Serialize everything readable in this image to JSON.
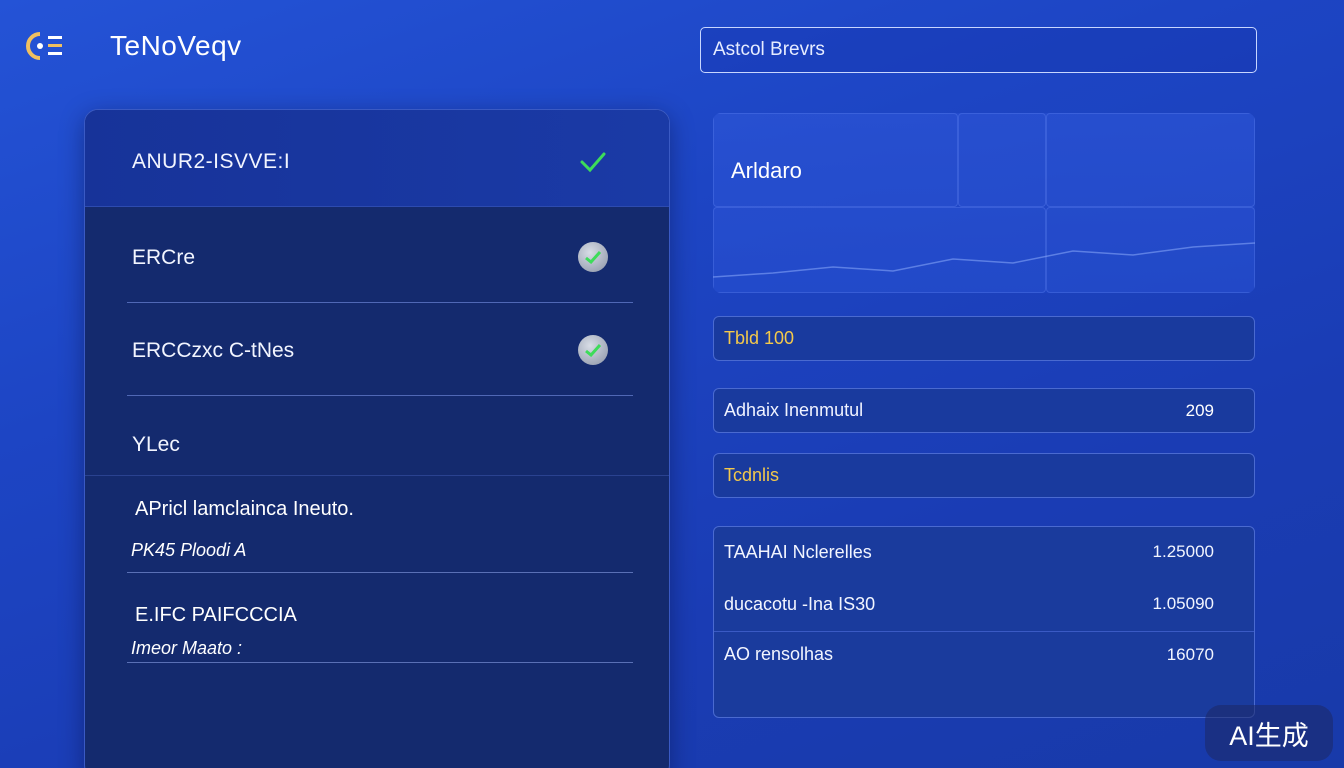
{
  "header": {
    "app_title": "TeNoVeqv",
    "search_value": "Astcol Brevrs"
  },
  "left_panel": {
    "rows": [
      {
        "label": "ANUR2-ISVVE:I",
        "status": "check-icon"
      },
      {
        "label": "ERCre",
        "status": "status-dot"
      },
      {
        "label": "ERCCzxc C-tNes",
        "status": "status-dot"
      },
      {
        "label": "YLec",
        "status": ""
      }
    ],
    "details": [
      {
        "title": "APricl lamclainca Ineuto.",
        "sub": "PK45 Ploodi A"
      },
      {
        "title": "E.IFC PAIFCCCIA",
        "sub": "Imeor Maato :"
      }
    ]
  },
  "right_panel": {
    "chart_title": "Arldaro",
    "rows": [
      {
        "label": "Tbld 100",
        "value": "",
        "highlight": "#f3c84b"
      },
      {
        "label": "Adhaix Inenmutul",
        "value": "209"
      },
      {
        "label": "Tcdnlis",
        "value": "",
        "highlight": "#f3c84b"
      }
    ],
    "table": [
      {
        "label": "TAAHAI Nclerelles",
        "value": "1.25000"
      },
      {
        "label": "ducacotu -Ina IS30",
        "value": "1.05090"
      },
      {
        "label": "AO rensolhas",
        "value": "16070"
      }
    ]
  },
  "watermark": "AI生成",
  "colors": {
    "accent_green": "#3ddc5a",
    "accent_yellow": "#f3c84b",
    "background": "#1d45c4"
  }
}
